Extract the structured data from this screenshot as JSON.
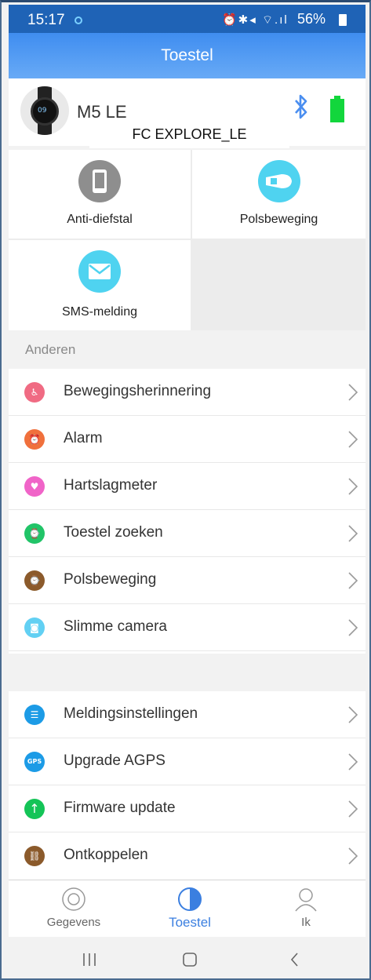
{
  "status": {
    "time": "15:17",
    "icons": "⏰✱◂ ⌔.ıl",
    "battery": "56%"
  },
  "header": {
    "title": "Toestel"
  },
  "device": {
    "name": "M5 LE",
    "caption": "FC EXPLORE_LE",
    "watch_face": "09"
  },
  "shortcuts": [
    {
      "label": "Anti-diefstal",
      "icon": "phone-icon",
      "color": "#8e8e8e"
    },
    {
      "label": "Polsbeweging",
      "icon": "wrist-icon",
      "color": "#4fd3f0"
    },
    {
      "label": "SMS-melding",
      "icon": "envelope-icon",
      "color": "#4fd3f0"
    }
  ],
  "section_label": "Anderen",
  "list1": [
    {
      "label": "Bewegingsherinnering",
      "icon": "sitting-icon",
      "color": "#f06b83"
    },
    {
      "label": "Alarm",
      "icon": "alarm-clock-icon",
      "color": "#f0703c"
    },
    {
      "label": "Hartslagmeter",
      "icon": "heart-icon",
      "color": "#f064c8"
    },
    {
      "label": "Toestel zoeken",
      "icon": "find-watch-icon",
      "color": "#21c468"
    },
    {
      "label": "Polsbeweging",
      "icon": "wrist-watch-icon",
      "color": "#8b5a2b"
    },
    {
      "label": "Slimme camera",
      "icon": "camera-icon",
      "color": "#62d0f3"
    }
  ],
  "list2": [
    {
      "label": "Meldingsinstellingen",
      "icon": "message-icon",
      "color": "#1c9be6"
    },
    {
      "label": "Upgrade AGPS",
      "icon": "gps-icon",
      "color": "#1c9be6",
      "glyph": "GPS"
    },
    {
      "label": "Firmware update",
      "icon": "arrow-up-icon",
      "color": "#14c457"
    },
    {
      "label": "Ontkoppelen",
      "icon": "unlink-icon",
      "color": "#8b5a2b"
    }
  ],
  "tabs": [
    {
      "label": "Gegevens",
      "icon": "target-icon"
    },
    {
      "label": "Toestel",
      "icon": "half-circle-icon"
    },
    {
      "label": "Ik",
      "icon": "user-icon"
    }
  ],
  "colors": {
    "accent": "#3b7fe0",
    "header": "#4a91f2",
    "bluetooth": "#4a8ef0",
    "battery": "#12d63c"
  }
}
